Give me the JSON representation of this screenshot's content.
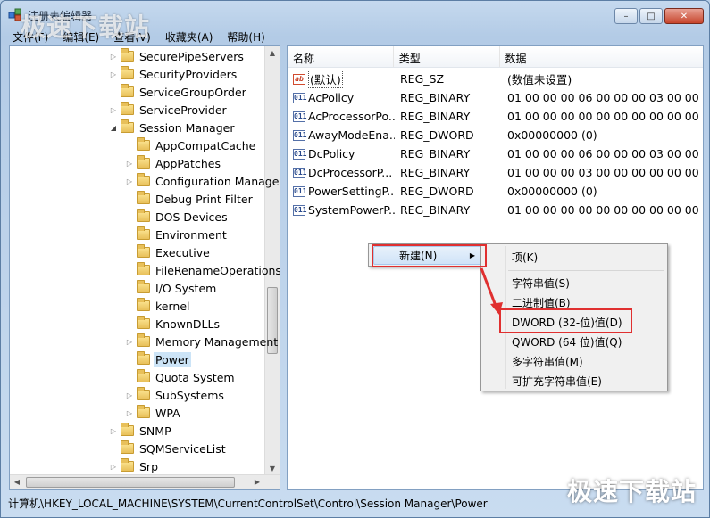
{
  "window": {
    "title": "注册表编辑器",
    "controls": {
      "minimize": "–",
      "maximize": "□",
      "close": "✕"
    }
  },
  "watermark": {
    "text": "极速下载站"
  },
  "menubar": {
    "items": [
      "文件(F)",
      "编辑(E)",
      "查看(V)",
      "收藏夹(A)",
      "帮助(H)"
    ]
  },
  "tree": {
    "items": [
      {
        "label": "SecurePipeServers",
        "expander": "▷"
      },
      {
        "label": "SecurityProviders",
        "expander": "▷"
      },
      {
        "label": "ServiceGroupOrder",
        "expander": ""
      },
      {
        "label": "ServiceProvider",
        "expander": "▷"
      },
      {
        "label": "Session Manager",
        "expander": "◢"
      },
      {
        "label": "AppCompatCache",
        "expander": ""
      },
      {
        "label": "AppPatches",
        "expander": "▷"
      },
      {
        "label": "Configuration Manager",
        "expander": "▷"
      },
      {
        "label": "Debug Print Filter",
        "expander": ""
      },
      {
        "label": "DOS Devices",
        "expander": ""
      },
      {
        "label": "Environment",
        "expander": ""
      },
      {
        "label": "Executive",
        "expander": ""
      },
      {
        "label": "FileRenameOperations",
        "expander": ""
      },
      {
        "label": "I/O System",
        "expander": ""
      },
      {
        "label": "kernel",
        "expander": ""
      },
      {
        "label": "KnownDLLs",
        "expander": ""
      },
      {
        "label": "Memory Management",
        "expander": "▷"
      },
      {
        "label": "Power",
        "expander": ""
      },
      {
        "label": "Quota System",
        "expander": ""
      },
      {
        "label": "SubSystems",
        "expander": "▷"
      },
      {
        "label": "WPA",
        "expander": "▷"
      },
      {
        "label": "SNMP",
        "expander": "▷"
      },
      {
        "label": "SQMServiceList",
        "expander": ""
      },
      {
        "label": "Srp",
        "expander": "▷"
      }
    ]
  },
  "list": {
    "columns": {
      "name": "名称",
      "type": "类型",
      "data": "数据"
    },
    "rows": [
      {
        "name": "(默认)",
        "type": "REG_SZ",
        "data": "(数值未设置)",
        "icon": "ab"
      },
      {
        "name": "AcPolicy",
        "type": "REG_BINARY",
        "data": "01 00 00 00 06 00 00 00 03 00 00 00 0",
        "icon": "011"
      },
      {
        "name": "AcProcessorPo...",
        "type": "REG_BINARY",
        "data": "01 00 00 00 00 00 00 00 00 00 00 00 0",
        "icon": "011"
      },
      {
        "name": "AwayModeEna...",
        "type": "REG_DWORD",
        "data": "0x00000000 (0)",
        "icon": "011"
      },
      {
        "name": "DcPolicy",
        "type": "REG_BINARY",
        "data": "01 00 00 00 06 00 00 00 03 00 00 00 0",
        "icon": "011"
      },
      {
        "name": "DcProcessorP...",
        "type": "REG_BINARY",
        "data": "01 00 00 00 03 00 00 00 00 00 00 00 0",
        "icon": "011"
      },
      {
        "name": "PowerSettingP...",
        "type": "REG_DWORD",
        "data": "0x00000000 (0)",
        "icon": "011"
      },
      {
        "name": "SystemPowerP...",
        "type": "REG_BINARY",
        "data": "01 00 00 00 00 00 00 00 00 00 00 00 1",
        "icon": "011"
      }
    ]
  },
  "context_menu": {
    "new_label": "新建(N)",
    "submenu_arrow": "▶",
    "submenu": [
      "项(K)",
      "字符串值(S)",
      "二进制值(B)",
      "DWORD (32-位)值(D)",
      "QWORD (64 位)值(Q)",
      "多字符串值(M)",
      "可扩充字符串值(E)"
    ]
  },
  "status_bar": {
    "path": "计算机\\HKEY_LOCAL_MACHINE\\SYSTEM\\CurrentControlSet\\Control\\Session Manager\\Power"
  },
  "colors": {
    "highlight_box": "#e03030",
    "selection": "#cce4f7"
  }
}
